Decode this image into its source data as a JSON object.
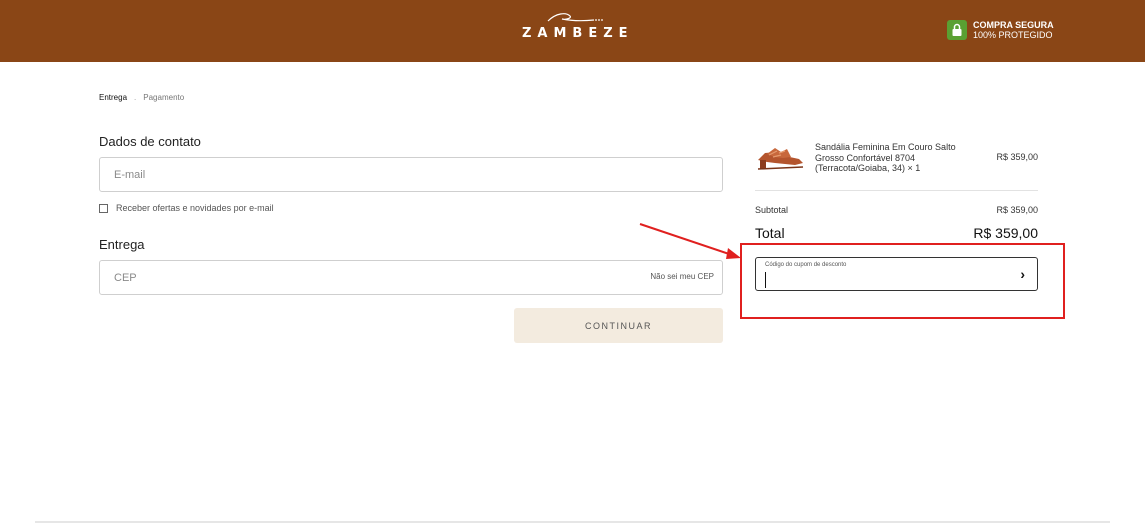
{
  "header": {
    "logo_text": "ZAMBEZE",
    "secure_title": "COMPRA SEGURA",
    "secure_subtitle": "100% PROTEGIDO",
    "bg_color": "#8a4616",
    "badge_icon": "lock-icon"
  },
  "breadcrumb": {
    "steps": [
      {
        "label": "Entrega",
        "active": true
      },
      {
        "label": "Pagamento",
        "active": false
      }
    ]
  },
  "contact": {
    "title": "Dados de contato",
    "email_placeholder": "E-mail",
    "email_value": "",
    "newsletter_label": "Receber ofertas e novidades por e-mail",
    "newsletter_checked": false
  },
  "delivery": {
    "title": "Entrega",
    "cep_placeholder": "CEP",
    "cep_value": "",
    "unknown_cep_link": "Não sei meu CEP"
  },
  "continue_label": "CONTINUAR",
  "summary": {
    "product": {
      "name": "Sandália Feminina Em Couro Salto Grosso Confortável 8704 (Terracota/Goiaba, 34) × 1",
      "price": "R$ 359,00"
    },
    "subtotal_label": "Subtotal",
    "subtotal_value": "R$ 359,00",
    "total_label": "Total",
    "total_value": "R$ 359,00",
    "coupon_label": "Código do cupom de desconto",
    "coupon_value": ""
  },
  "annotation": {
    "color": "#e0201f"
  }
}
